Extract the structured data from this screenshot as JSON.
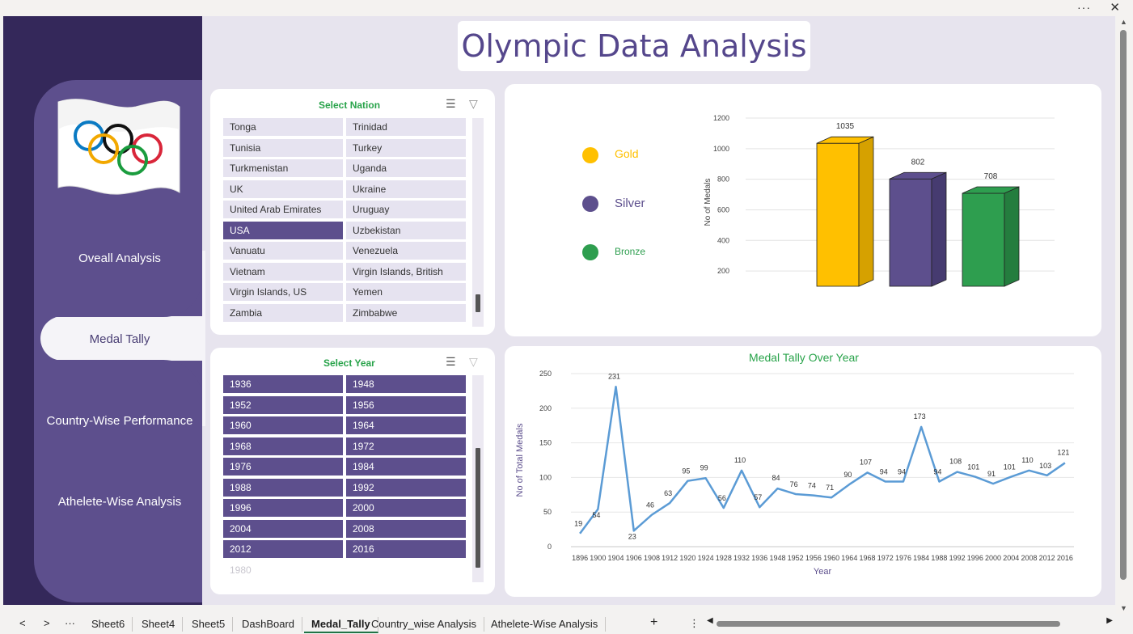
{
  "title": "Olympic Data Analysis",
  "topbar": {
    "more": "···",
    "close": "✕"
  },
  "nav": {
    "items": [
      {
        "label": "Oveall Analysis"
      },
      {
        "label": "Medal Tally"
      },
      {
        "label": "Country-Wise Performance"
      },
      {
        "label": "Athelete-Wise Analysis"
      }
    ]
  },
  "nation_slicer": {
    "title": "Select Nation",
    "items": [
      "Tonga",
      "Trinidad",
      "Tunisia",
      "Turkey",
      "Turkmenistan",
      "Uganda",
      "UK",
      "Ukraine",
      "United Arab Emirates",
      "Uruguay",
      "USA",
      "Uzbekistan",
      "Vanuatu",
      "Venezuela",
      "Vietnam",
      "Virgin Islands, British",
      "Virgin Islands, US",
      "Yemen",
      "Zambia",
      "Zimbabwe"
    ],
    "selected": "USA"
  },
  "year_slicer": {
    "title": "Select Year",
    "items": [
      "1936",
      "1948",
      "1952",
      "1956",
      "1960",
      "1964",
      "1968",
      "1972",
      "1976",
      "1984",
      "1988",
      "1992",
      "1996",
      "2000",
      "2004",
      "2008",
      "2012",
      "2016"
    ],
    "ghost": "1980"
  },
  "medal_legend": [
    {
      "label": "Gold",
      "color": "#ffc000"
    },
    {
      "label": "Silver",
      "color": "#5d4f8d"
    },
    {
      "label": "Bronze",
      "color": "#2e9e4f"
    }
  ],
  "chart_data": [
    {
      "type": "bar",
      "categories": [
        "Gold",
        "Silver",
        "Bronze"
      ],
      "values": [
        1035,
        802,
        708
      ],
      "ylabel": "No of Medals",
      "yticks": [
        200,
        400,
        600,
        800,
        1000,
        1200
      ],
      "colors": [
        "#ffc000",
        "#5d4f8d",
        "#2e9e4f"
      ]
    },
    {
      "type": "line",
      "title": "Medal Tally Over Year",
      "xlabel": "Year",
      "ylabel": "No of Total Medals",
      "ylim": [
        0,
        250
      ],
      "yticks": [
        0,
        50,
        100,
        150,
        200,
        250
      ],
      "x": [
        "1896",
        "1900",
        "1904",
        "1906",
        "1908",
        "1912",
        "1920",
        "1924",
        "1928",
        "1932",
        "1936",
        "1948",
        "1952",
        "1956",
        "1960",
        "1964",
        "1968",
        "1972",
        "1976",
        "1984",
        "1988",
        "1992",
        "1996",
        "2000",
        "2004",
        "2008",
        "2012",
        "2016"
      ],
      "values": [
        19,
        54,
        231,
        23,
        46,
        63,
        95,
        99,
        56,
        110,
        57,
        84,
        76,
        74,
        71,
        90,
        107,
        94,
        94,
        173,
        94,
        108,
        101,
        91,
        101,
        110,
        103,
        121
      ],
      "color": "#5b9bd5"
    }
  ],
  "sheet_tabs": [
    "Sheet6",
    "Sheet4",
    "Sheet5",
    "DashBoard",
    "Medal_Tally",
    "Country_wise Analysis",
    "Athelete-Wise Analysis"
  ],
  "active_tab": "Medal_Tally",
  "tab_nav": {
    "prev": "<",
    "next": ">",
    "more": "···",
    "add": "+",
    "menu": "⋮"
  }
}
